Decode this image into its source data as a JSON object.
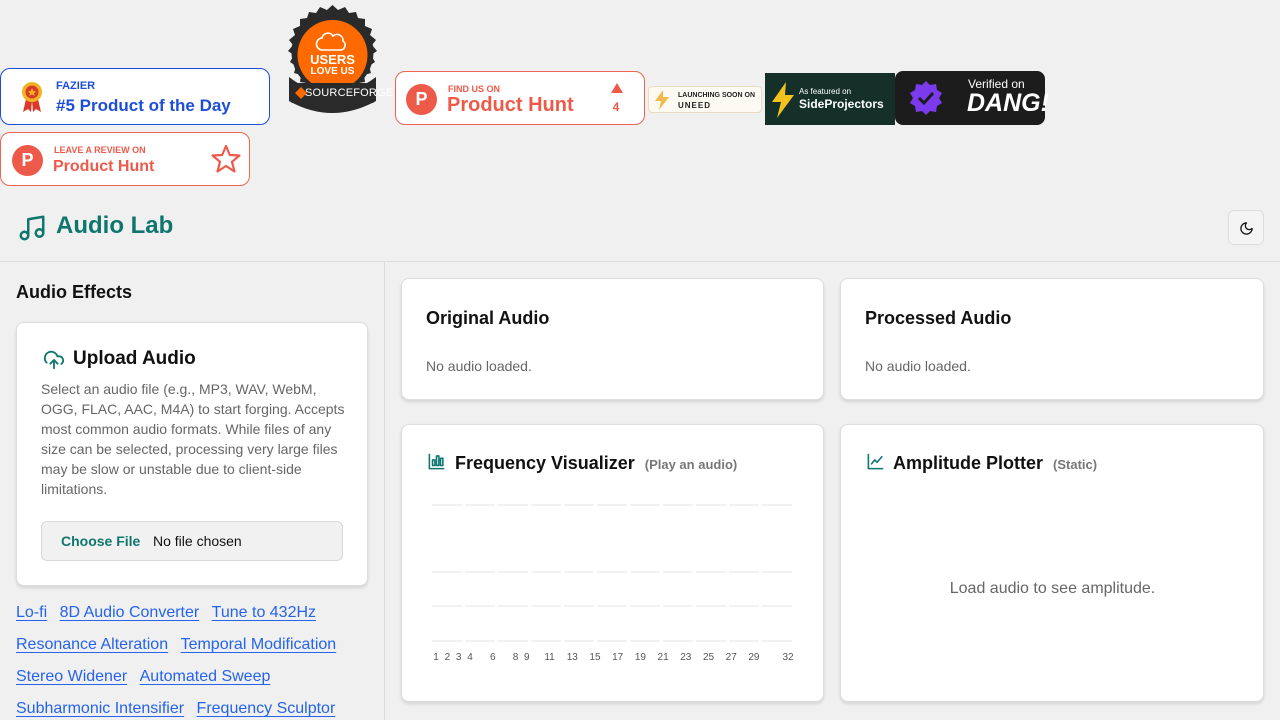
{
  "badges": {
    "fazier": {
      "small": "FAZIER",
      "big": "#5 Product of the Day"
    },
    "sourceforge": {
      "line1": "USERS",
      "line2": "LOVE US",
      "brand": "SOURCEFORGE"
    },
    "producthunt": {
      "small": "FIND US ON",
      "big": "Product Hunt",
      "votes": "4"
    },
    "uneed": {
      "line1": "LAUNCHING SOON ON",
      "line2": "UNEED"
    },
    "sideprojectors": {
      "line1": "As featured on",
      "line2": "SideProjectors"
    },
    "dang": {
      "line1": "Verified on",
      "line2": "DANG!"
    },
    "review": {
      "small": "LEAVE A REVIEW ON",
      "big": "Product Hunt"
    }
  },
  "header": {
    "title": "Audio Lab"
  },
  "sidebar": {
    "title": "Audio Effects",
    "upload": {
      "title": "Upload Audio",
      "description": "Select an audio file (e.g., MP3, WAV, WebM, OGG, FLAC, AAC, M4A) to start forging. Accepts most common audio formats. While files of any size can be selected, processing very large files may be slow or unstable due to client-side limitations.",
      "choose_label": "Choose File",
      "file_status": "No file chosen"
    },
    "effects": [
      [
        "Lo-fi",
        "8D Audio Converter",
        "Tune to 432Hz"
      ],
      [
        "Resonance Alteration",
        "Temporal Modification"
      ],
      [
        "Stereo Widener",
        "Automated Sweep"
      ],
      [
        "Subharmonic Intensifier",
        "Frequency Sculptor"
      ]
    ]
  },
  "original": {
    "title": "Original Audio",
    "status": "No audio loaded."
  },
  "processed": {
    "title": "Processed Audio",
    "status": "No audio loaded."
  },
  "frequency": {
    "title": "Frequency Visualizer",
    "subtitle": "(Play an audio)",
    "ticks": [
      "1",
      "2",
      "3",
      "4",
      "6",
      "8",
      "9",
      "11",
      "13",
      "15",
      "17",
      "19",
      "21",
      "23",
      "25",
      "27",
      "29",
      "32"
    ]
  },
  "amplitude": {
    "title": "Amplitude Plotter",
    "subtitle": "(Static)",
    "empty": "Load audio to see amplitude."
  },
  "colors": {
    "accent": "#0f766e",
    "link": "#2563eb",
    "producthunt": "#ee5a4a",
    "fazier": "#1d4ed8"
  }
}
